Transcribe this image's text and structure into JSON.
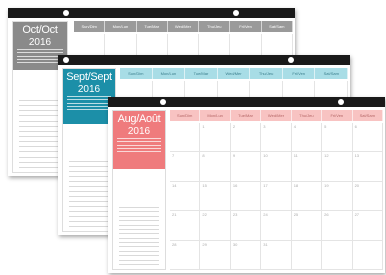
{
  "calendars": [
    {
      "id": "oct",
      "month": "Oct/Oct",
      "year": "2016",
      "accent": "#8a8a8a",
      "days": [
        "Sun/Dim",
        "Mon/Lun",
        "Tue/Mar",
        "Wed/Mer",
        "Thu/Jeu",
        "Fri/Ven",
        "Sat/Sam"
      ],
      "dates": []
    },
    {
      "id": "sep",
      "month": "Sept/Sept",
      "year": "2016",
      "accent": "#1c8fa8",
      "days": [
        "Sun/Dim",
        "Mon/Lun",
        "Tue/Mar",
        "Wed/Mer",
        "Thu/Jeu",
        "Fri/Ven",
        "Sat/Sam"
      ],
      "dates": []
    },
    {
      "id": "aug",
      "month": "Aug/Août",
      "year": "2016",
      "accent": "#ef7b7d",
      "days": [
        "Sun/Dim",
        "Mon/Lun",
        "Tue/Mar",
        "Wed/Mer",
        "Thu/Jeu",
        "Fri/Ven",
        "Sat/Sam"
      ],
      "dates": [
        "",
        "1",
        "2",
        "3",
        "4",
        "5",
        "6",
        "7",
        "8",
        "9",
        "10",
        "11",
        "12",
        "13",
        "14",
        "15",
        "16",
        "17",
        "18",
        "19",
        "20",
        "21",
        "22",
        "23",
        "24",
        "25",
        "26",
        "27",
        "28",
        "29",
        "30",
        "31",
        "",
        "",
        ""
      ]
    }
  ]
}
